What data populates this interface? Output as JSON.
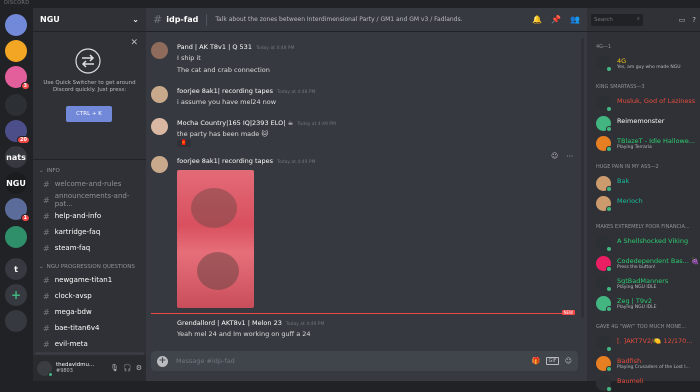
{
  "app": {
    "title": "DISCORD"
  },
  "guilds": [
    {
      "label": "",
      "color": "#7289da",
      "badge": ""
    },
    {
      "label": "",
      "color": "#f3a623",
      "badge": ""
    },
    {
      "label": "",
      "color": "#e35f9b",
      "badge": "3"
    },
    {
      "label": "",
      "color": "#2c2f33",
      "badge": ""
    },
    {
      "label": "",
      "color": "#4c4e8a",
      "badge": "20"
    },
    {
      "label": "nats",
      "color": "#36393f",
      "badge": ""
    },
    {
      "label": "NGU",
      "color": "#1b1c1e",
      "badge": ""
    },
    {
      "label": "",
      "color": "#5b6c9a",
      "badge": "1"
    },
    {
      "label": "",
      "color": "#2f8f6a",
      "badge": ""
    },
    {
      "label": "t",
      "color": "#36393f",
      "badge": ""
    },
    {
      "label": "+",
      "color": "#36393f",
      "badge": ""
    },
    {
      "label": "",
      "color": "#36393f",
      "badge": ""
    }
  ],
  "server": {
    "name": "NGU"
  },
  "quick_switcher": {
    "text": "Use Quick Switcher to get around Discord quickly. Just press:",
    "button": "CTRL + K"
  },
  "categories": {
    "info": "INFO",
    "progression": "NGU PROGRESSION QUESTIONS"
  },
  "channels_info": [
    {
      "name": "welcome-and-rules",
      "state": "muted"
    },
    {
      "name": "announcements-and-pat...",
      "state": "muted"
    },
    {
      "name": "help-and-info",
      "state": "unread"
    },
    {
      "name": "kartridge-faq",
      "state": "unread"
    },
    {
      "name": "steam-faq",
      "state": "unread"
    }
  ],
  "channels_prog": [
    {
      "name": "newgame-titan1",
      "state": "unread"
    },
    {
      "name": "clock-avsp",
      "state": "unread"
    },
    {
      "name": "mega-bdw",
      "state": "unread"
    },
    {
      "name": "bae-titan6v4",
      "state": "unread"
    },
    {
      "name": "evil-meta",
      "state": "unread"
    },
    {
      "name": "idp-fad",
      "state": "active"
    },
    {
      "name": "jrpg-titan9v4",
      "state": "unread"
    }
  ],
  "user": {
    "name": "thedavidmu...",
    "tag": "#9803"
  },
  "channel": {
    "name": "idp-fad",
    "topic": "Talk about the zones between Interdimensional Party / GM1 and GM v3 / Fadlands."
  },
  "messages": [
    {
      "author": "Pand | AK T8v1 | Q 531",
      "time": "Today at 4:48 PM",
      "lines": [
        "I ship it",
        "The cat and crab connection"
      ],
      "color": "#ffffff"
    },
    {
      "author": "foorjee 8ak1| recording tapes",
      "time": "Today at 4:48 PM",
      "lines": [
        "i assume you have mel24 now"
      ],
      "color": "#ffffff"
    },
    {
      "author": "Mocha Country|165 IQ|2393 ELO| ☕",
      "time": "Today at 4:49 PM",
      "lines": [
        "the party has been made 🐱"
      ],
      "color": "#ffffff"
    },
    {
      "author": "foorjee 8ak1| recording tapes",
      "time": "Today at 4:49 PM",
      "lines": [],
      "color": "#ffffff"
    },
    {
      "author": "Grendallord | AKT8v1 | Melon 23",
      "time": "Today at 4:49 PM",
      "lines": [
        "Yeah mel 24 and Im working on guff a 24"
      ],
      "color": "#ffffff"
    }
  ],
  "new_label": "NEW",
  "composer": {
    "placeholder": "Message #idp-fad",
    "gif": "GIF"
  },
  "search": {
    "placeholder": "Search"
  },
  "member_groups": [
    {
      "title": "4G—1",
      "members": [
        {
          "name": "4G",
          "sub": "Yes, am guy who made NGU",
          "color": "#f1c40f",
          "avatar": "#2c2f33"
        }
      ]
    },
    {
      "title": "KING SMARTASS—3",
      "members": [
        {
          "name": "Musluk, God of Laziness",
          "sub": "",
          "color": "#e74c3c",
          "avatar": "#2c2f33"
        },
        {
          "name": "Reimemonster",
          "sub": "",
          "color": "#ffffff",
          "avatar": "#43b581"
        },
        {
          "name": "TBlazeT - Idle Hallowe...",
          "sub": "Playing Terraria",
          "color": "#2ecc71",
          "avatar": "#e67e22"
        }
      ]
    },
    {
      "title": "HUGE PAIN IN MY ASS—2",
      "members": [
        {
          "name": "Bak",
          "sub": "",
          "color": "#1abc9c",
          "avatar": "#cc9b6d"
        },
        {
          "name": "Merioch",
          "sub": "",
          "color": "#1abc9c",
          "avatar": "#cc9b6d"
        }
      ]
    },
    {
      "title": "MAKES EXTREMELY POOR FINANCIA...",
      "members": [
        {
          "name": "A Shellshocked Viking",
          "sub": "",
          "color": "#2ecc71",
          "avatar": "#2c2f33"
        },
        {
          "name": "Codedependent Bas... 🍇",
          "sub": "Press the button!",
          "color": "#2ecc71",
          "avatar": "#e91e63"
        },
        {
          "name": "SgtBadManners",
          "sub": "Playing NGU IDLE",
          "color": "#2ecc71",
          "avatar": "#2c2f33"
        },
        {
          "name": "Zeg | T9v2",
          "sub": "Playing NGU IDLE",
          "color": "#2ecc71",
          "avatar": "#43b581"
        }
      ]
    },
    {
      "title": "GAVE 4G \"WAY\" TOO MUCH MONE...",
      "members": [
        {
          "name": "[. ]AKT7V2/🍋 12/170...",
          "sub": "",
          "color": "#e74c3c",
          "avatar": "#2c2f33"
        },
        {
          "name": "Badfish",
          "sub": "Playing Crusaders of the Lost I...",
          "color": "#e74c3c",
          "avatar": "#e67e22"
        },
        {
          "name": "Baumeli",
          "sub": "",
          "color": "#e74c3c",
          "avatar": "#2c2f33"
        }
      ]
    }
  ]
}
